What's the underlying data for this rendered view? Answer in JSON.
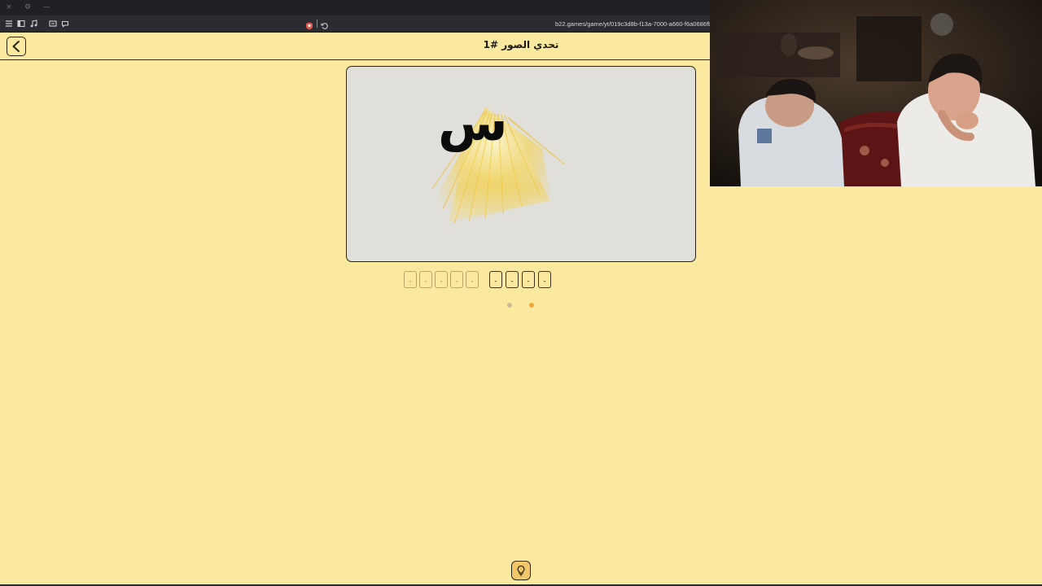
{
  "browser": {
    "url": "b22.games/game/yt/019c3d8b-f13a-7000-a660-f6a0686fb",
    "window_buttons": [
      "×",
      "⚙",
      "—"
    ]
  },
  "page": {
    "title": "تحدي الصور #1"
  },
  "puzzle": {
    "image_letter": "س",
    "answer_words": [
      {
        "slots": [
          "-",
          "-",
          "-",
          "-",
          "-"
        ]
      },
      {
        "slots": [
          "-",
          "-",
          "-",
          "-"
        ]
      }
    ],
    "progress": {
      "current_index": 1,
      "total": 2
    }
  },
  "colors": {
    "page_background": "#fbe9a0",
    "accent_dot": "#f0a93a",
    "inactive_dot": "#c9bb93",
    "hint_button": "#f2c76a"
  },
  "icons": [
    "back-arrow-icon",
    "lightbulb-icon"
  ]
}
